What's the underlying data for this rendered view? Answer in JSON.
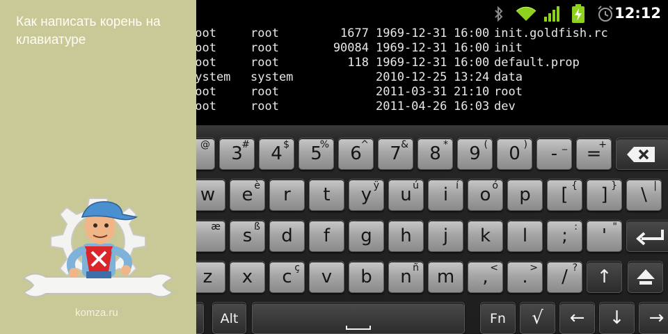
{
  "article": {
    "title": "Как написать корень на клавиатуре",
    "site": "komza.ru"
  },
  "status_bar": {
    "icons": [
      "bluetooth-icon",
      "wifi-icon",
      "signal-icon",
      "battery-charging-icon",
      "alarm-icon"
    ],
    "time": "12:12",
    "accent_color": "#8fd11f"
  },
  "terminal": {
    "rows": [
      {
        "user": "root",
        "group": "root",
        "size": "1677",
        "date": "1969-12-31",
        "time": "16:00",
        "name": "init.goldfish.rc"
      },
      {
        "user": "root",
        "group": "root",
        "size": "90084",
        "date": "1969-12-31",
        "time": "16:00",
        "name": "init"
      },
      {
        "user": "root",
        "group": "root",
        "size": "118",
        "date": "1969-12-31",
        "time": "16:00",
        "name": "default.prop"
      },
      {
        "user": "system",
        "group": "system",
        "size": "",
        "date": "2010-12-25",
        "time": "13:24",
        "name": "data"
      },
      {
        "user": "root",
        "group": "root",
        "size": "",
        "date": "2011-03-31",
        "time": "21:10",
        "name": "root"
      },
      {
        "user": "root",
        "group": "root",
        "size": "",
        "date": "2011-04-26",
        "time": "16:03",
        "name": "dev"
      }
    ]
  },
  "keyboard": {
    "rows": [
      [
        {
          "main": "",
          "sub": "@",
          "name": "key-2"
        },
        {
          "main": "3",
          "sub": "#",
          "name": "key-3"
        },
        {
          "main": "4",
          "sub": "$",
          "name": "key-4"
        },
        {
          "main": "5",
          "sub": "%",
          "name": "key-5"
        },
        {
          "main": "6",
          "sub": "^",
          "name": "key-6"
        },
        {
          "main": "7",
          "sub": "&",
          "name": "key-7"
        },
        {
          "main": "8",
          "sub": "*",
          "name": "key-8"
        },
        {
          "main": "9",
          "sub": "(",
          "name": "key-9"
        },
        {
          "main": "0",
          "sub": ")",
          "name": "key-0"
        },
        {
          "main": "-",
          "sub": "_",
          "name": "key-minus"
        },
        {
          "main": "=",
          "sub": "+",
          "name": "key-equals"
        },
        {
          "main": "",
          "sub": "",
          "name": "backspace-key",
          "icon": "backspace-icon"
        }
      ],
      [
        {
          "main": "w",
          "sub": "",
          "name": "key-w"
        },
        {
          "main": "e",
          "sub": "è",
          "name": "key-e"
        },
        {
          "main": "r",
          "sub": "",
          "name": "key-r"
        },
        {
          "main": "t",
          "sub": "",
          "name": "key-t"
        },
        {
          "main": "y",
          "sub": "ÿ",
          "name": "key-y"
        },
        {
          "main": "u",
          "sub": "ú",
          "name": "key-u"
        },
        {
          "main": "i",
          "sub": "í",
          "name": "key-i"
        },
        {
          "main": "o",
          "sub": "ó",
          "name": "key-o"
        },
        {
          "main": "p",
          "sub": "",
          "name": "key-p"
        },
        {
          "main": "[",
          "sub": "{",
          "name": "key-left-bracket"
        },
        {
          "main": "]",
          "sub": "}",
          "name": "key-right-bracket"
        },
        {
          "main": "\\",
          "sub": "|",
          "name": "key-backslash"
        }
      ],
      [
        {
          "main": "",
          "sub": "æ",
          "name": "key-a"
        },
        {
          "main": "s",
          "sub": "ß",
          "name": "key-s"
        },
        {
          "main": "d",
          "sub": "",
          "name": "key-d"
        },
        {
          "main": "f",
          "sub": "",
          "name": "key-f"
        },
        {
          "main": "g",
          "sub": "",
          "name": "key-g"
        },
        {
          "main": "h",
          "sub": "",
          "name": "key-h"
        },
        {
          "main": "j",
          "sub": "",
          "name": "key-j"
        },
        {
          "main": "k",
          "sub": "",
          "name": "key-k"
        },
        {
          "main": "l",
          "sub": "",
          "name": "key-l"
        },
        {
          "main": ";",
          "sub": ":",
          "name": "key-semicolon"
        },
        {
          "main": "'",
          "sub": "\"",
          "name": "key-quote"
        },
        {
          "main": "",
          "sub": "",
          "name": "enter-key",
          "icon": "enter-icon"
        }
      ],
      [
        {
          "main": "z",
          "sub": "",
          "name": "key-z"
        },
        {
          "main": "x",
          "sub": "",
          "name": "key-x"
        },
        {
          "main": "c",
          "sub": "ç",
          "name": "key-c"
        },
        {
          "main": "v",
          "sub": "",
          "name": "key-v"
        },
        {
          "main": "b",
          "sub": "",
          "name": "key-b"
        },
        {
          "main": "n",
          "sub": "ñ",
          "name": "key-n"
        },
        {
          "main": "m",
          "sub": "",
          "name": "key-m"
        },
        {
          "main": ",",
          "sub": "<",
          "name": "key-comma"
        },
        {
          "main": ".",
          "sub": ">",
          "name": "key-period"
        },
        {
          "main": "/",
          "sub": "?",
          "name": "key-slash"
        },
        {
          "main": "↑",
          "sub": "",
          "name": "arrow-up-key"
        },
        {
          "main": "",
          "sub": "",
          "name": "shift-key",
          "icon": "shift-icon"
        }
      ],
      [
        {
          "main": "",
          "sub": "",
          "name": "ctrl-key"
        },
        {
          "main": "Alt",
          "sub": "",
          "name": "alt-key"
        },
        {
          "main": "",
          "sub": "",
          "name": "space-key",
          "icon": "space-icon"
        },
        {
          "main": "Fn",
          "sub": "",
          "name": "fn-key"
        },
        {
          "main": "√",
          "sub": "",
          "name": "sqrt-key"
        },
        {
          "main": "←",
          "sub": "",
          "name": "arrow-left-key"
        },
        {
          "main": "↓",
          "sub": "",
          "name": "arrow-down-key"
        },
        {
          "main": "→",
          "sub": "",
          "name": "arrow-right-key"
        }
      ]
    ]
  }
}
